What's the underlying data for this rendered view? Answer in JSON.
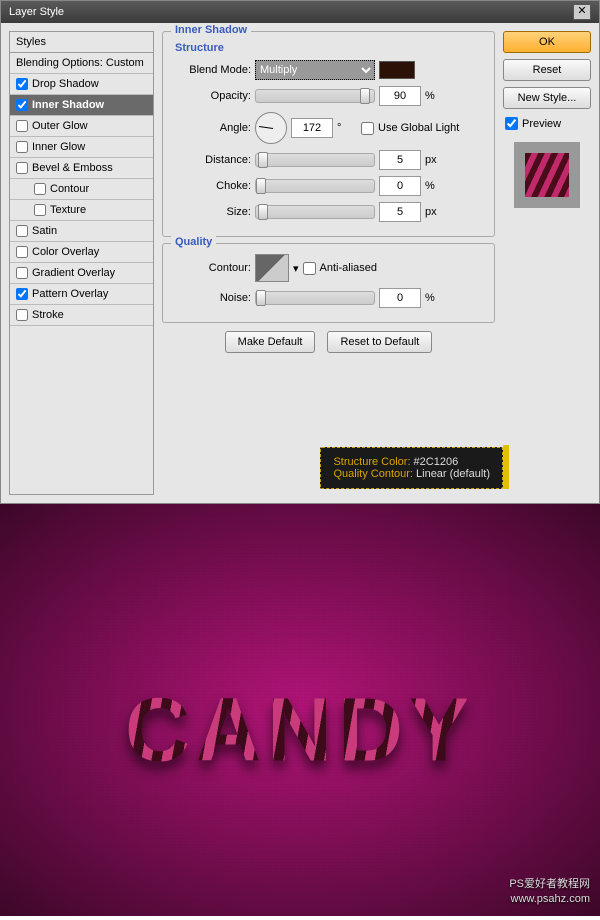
{
  "titlebar": {
    "title": "Layer Style",
    "close": "✕"
  },
  "styles_panel": {
    "header": "Styles",
    "blending": "Blending Options: Custom",
    "items": [
      {
        "label": "Drop Shadow",
        "checked": true,
        "selected": false
      },
      {
        "label": "Inner Shadow",
        "checked": true,
        "selected": true
      },
      {
        "label": "Outer Glow",
        "checked": false,
        "selected": false
      },
      {
        "label": "Inner Glow",
        "checked": false,
        "selected": false
      },
      {
        "label": "Bevel & Emboss",
        "checked": false,
        "selected": false
      },
      {
        "label": "Contour",
        "checked": false,
        "selected": false,
        "indent": true
      },
      {
        "label": "Texture",
        "checked": false,
        "selected": false,
        "indent": true
      },
      {
        "label": "Satin",
        "checked": false,
        "selected": false
      },
      {
        "label": "Color Overlay",
        "checked": false,
        "selected": false
      },
      {
        "label": "Gradient Overlay",
        "checked": false,
        "selected": false
      },
      {
        "label": "Pattern Overlay",
        "checked": true,
        "selected": false
      },
      {
        "label": "Stroke",
        "checked": false,
        "selected": false
      }
    ]
  },
  "center": {
    "heading": "Inner Shadow",
    "structure_title": "Structure",
    "blend_mode_label": "Blend Mode:",
    "blend_mode_value": "Multiply",
    "color": "#2C1206",
    "opacity_label": "Opacity:",
    "opacity_value": "90",
    "opacity_unit": "%",
    "angle_label": "Angle:",
    "angle_value": "172",
    "angle_unit": "°",
    "use_global": "Use Global Light",
    "distance_label": "Distance:",
    "distance_value": "5",
    "distance_unit": "px",
    "choke_label": "Choke:",
    "choke_value": "0",
    "choke_unit": "%",
    "size_label": "Size:",
    "size_value": "5",
    "size_unit": "px",
    "quality_title": "Quality",
    "contour_label": "Contour:",
    "antialiased": "Anti-aliased",
    "noise_label": "Noise:",
    "noise_value": "0",
    "noise_unit": "%",
    "make_default": "Make Default",
    "reset_default": "Reset to Default"
  },
  "right": {
    "ok": "OK",
    "reset": "Reset",
    "new_style": "New Style...",
    "preview": "Preview"
  },
  "tooltip": {
    "l1a": "Structure Color:",
    "l1b": " #2C1206",
    "l2a": "Quality Contour:",
    "l2b": " Linear (default)"
  },
  "result": {
    "text": "CANDY",
    "wm1": "PS爱好者教程网",
    "wm2": "www.psahz.com"
  }
}
